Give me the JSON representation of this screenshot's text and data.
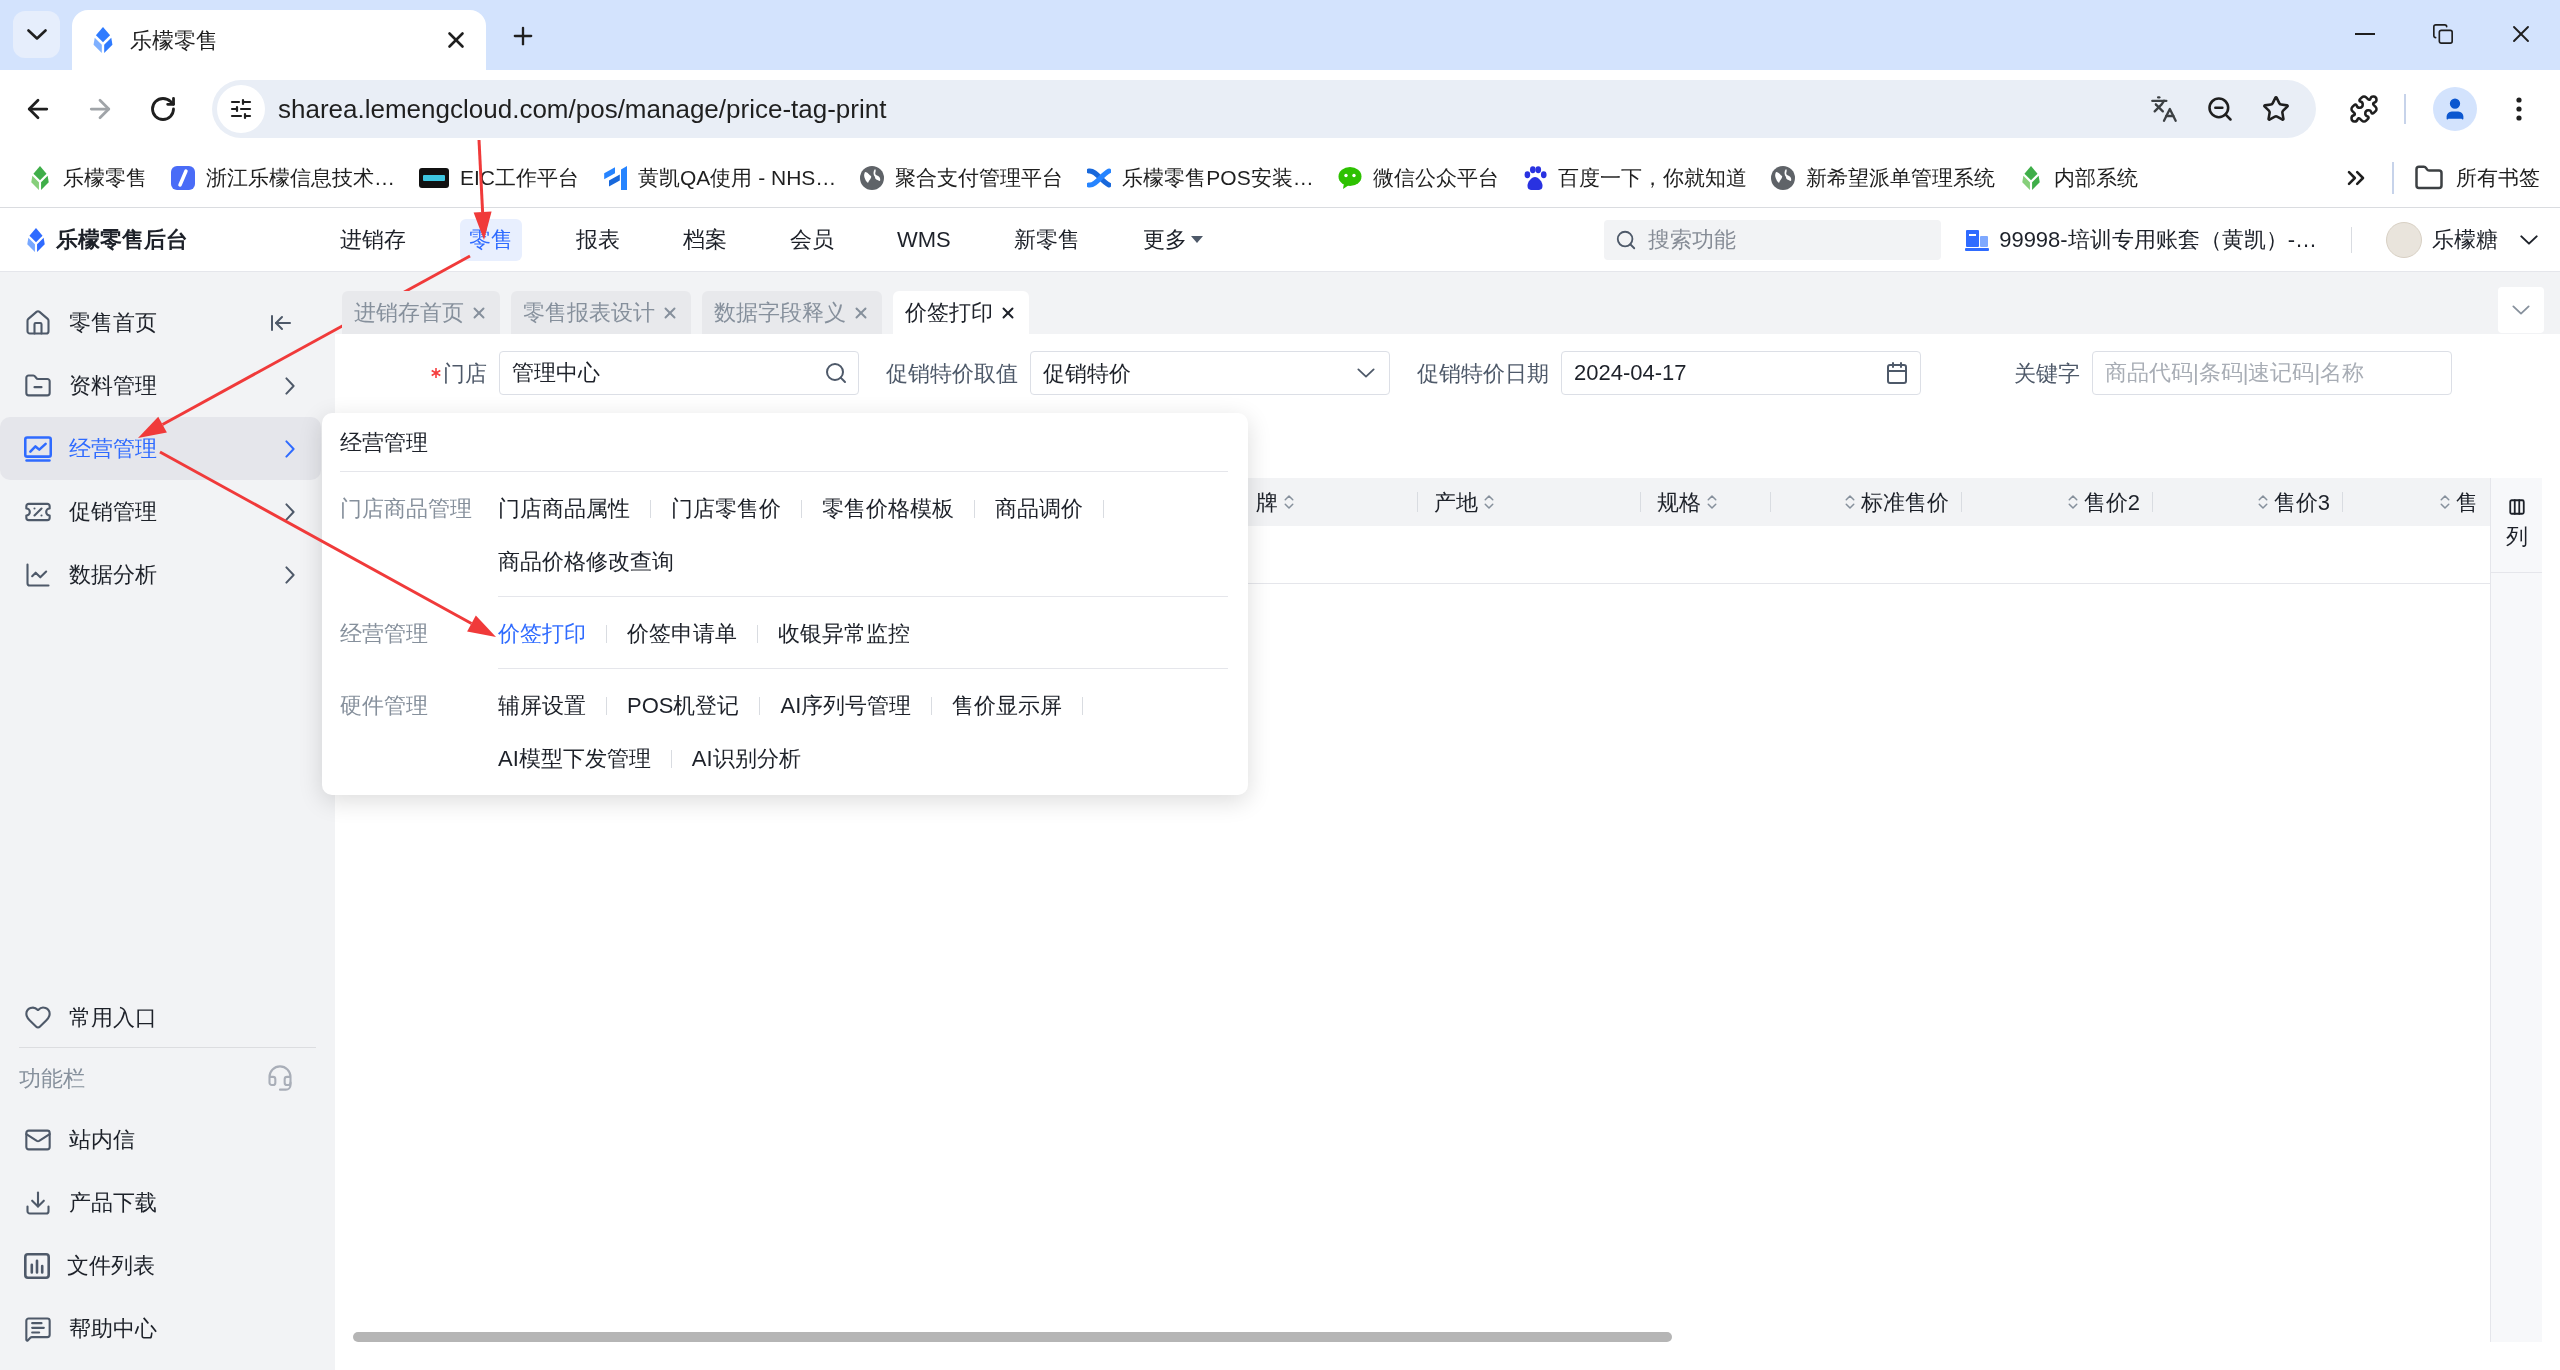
{
  "browser": {
    "tab_title": "乐檬零售",
    "url": "sharea.lemengcloud.com/pos/manage/price-tag-print",
    "bookmarks": [
      "乐檬零售",
      "浙江乐檬信息技术…",
      "EIC工作平台",
      "黄凯QA使用 - NHS…",
      "聚合支付管理平台",
      "乐檬零售POS安装…",
      "微信公众平台",
      "百度一下，你就知道",
      "新希望派单管理系统",
      "内部系统"
    ],
    "all_bookmarks": "所有书签"
  },
  "header": {
    "logo": "乐檬零售后台",
    "nav": [
      {
        "label": "进销存",
        "selected": false,
        "dropdown": false
      },
      {
        "label": "零售",
        "selected": true,
        "dropdown": false
      },
      {
        "label": "报表",
        "selected": false,
        "dropdown": false
      },
      {
        "label": "档案",
        "selected": false,
        "dropdown": false
      },
      {
        "label": "会员",
        "selected": false,
        "dropdown": false
      },
      {
        "label": "WMS",
        "selected": false,
        "dropdown": false
      },
      {
        "label": "新零售",
        "selected": false,
        "dropdown": false
      },
      {
        "label": "更多",
        "selected": false,
        "dropdown": true
      }
    ],
    "search": {
      "placeholder": "搜索功能"
    },
    "account": "99998-培训专用账套（黄凯）-…",
    "user": "乐檬糖"
  },
  "sidebar": {
    "items": [
      {
        "label": "零售首页",
        "selected": false,
        "expandable": false
      },
      {
        "label": "资料管理",
        "selected": false,
        "expandable": true
      },
      {
        "label": "经营管理",
        "selected": true,
        "expandable": true
      },
      {
        "label": "促销管理",
        "selected": false,
        "expandable": true
      },
      {
        "label": "数据分析",
        "selected": false,
        "expandable": true
      }
    ],
    "favorites": "常用入口",
    "section_title": "功能栏",
    "tools": [
      "站内信",
      "产品下载",
      "文件列表",
      "帮助中心"
    ]
  },
  "page_tabs": [
    {
      "label": "进销存首页",
      "selected": false
    },
    {
      "label": "零售报表设计",
      "selected": false
    },
    {
      "label": "数据字段释义",
      "selected": false
    },
    {
      "label": "价签打印",
      "selected": true
    }
  ],
  "filters": [
    {
      "kind": "search",
      "label": "门店",
      "required": true,
      "value": "管理中心"
    },
    {
      "kind": "select",
      "label": "促销特价取值",
      "required": false,
      "value": "促销特价"
    },
    {
      "kind": "date",
      "label": "促销特价日期",
      "required": false,
      "value": "2024-04-17"
    },
    {
      "kind": "text",
      "label": "关键字",
      "required": false,
      "placeholder": "商品代码|条码|速记码|名称"
    }
  ],
  "table": {
    "columns": [
      {
        "label": "牌",
        "kind": "text"
      },
      {
        "label": "产地",
        "kind": "text"
      },
      {
        "label": "规格",
        "kind": "text"
      },
      {
        "label": "标准售价",
        "kind": "price"
      },
      {
        "label": "售价2",
        "kind": "price"
      },
      {
        "label": "售价3",
        "kind": "price"
      },
      {
        "label": "售",
        "kind": "price"
      }
    ],
    "column_settings": "列"
  },
  "flyout": {
    "title": "经营管理",
    "groups": [
      {
        "title": "门店商品管理",
        "rows": [
          [
            {
              "label": "门店商品属性",
              "selected": false
            },
            {
              "label": "门店零售价",
              "selected": false
            },
            {
              "label": "零售价格模板",
              "selected": false
            },
            {
              "label": "商品调价",
              "selected": false
            }
          ],
          [
            {
              "label": "商品价格修改查询",
              "selected": false
            }
          ]
        ]
      },
      {
        "title": "经营管理",
        "rows": [
          [
            {
              "label": "价签打印",
              "selected": true
            },
            {
              "label": "价签申请单",
              "selected": false
            },
            {
              "label": "收银异常监控",
              "selected": false
            }
          ]
        ]
      },
      {
        "title": "硬件管理",
        "rows": [
          [
            {
              "label": "辅屏设置",
              "selected": false
            },
            {
              "label": "POS机登记",
              "selected": false
            },
            {
              "label": "AI序列号管理",
              "selected": false
            },
            {
              "label": "售价显示屏",
              "selected": false
            }
          ],
          [
            {
              "label": "AI模型下发管理",
              "selected": false
            },
            {
              "label": "AI识别分析",
              "selected": false
            }
          ]
        ]
      }
    ]
  }
}
